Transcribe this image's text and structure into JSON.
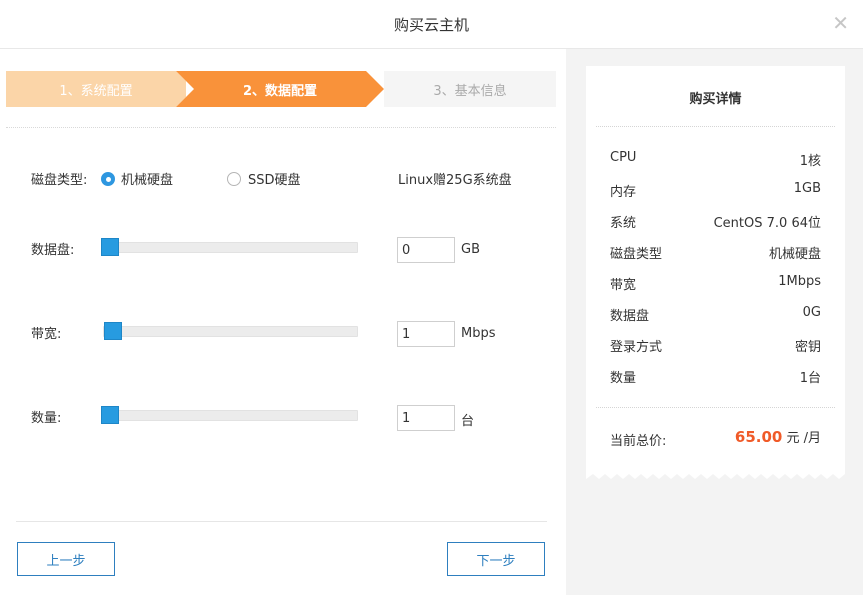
{
  "dialog": {
    "title": "购买云主机",
    "close_glyph": "✕"
  },
  "steps": [
    {
      "label": "1、系统配置",
      "state": "done"
    },
    {
      "label": "2、数据配置",
      "state": "active"
    },
    {
      "label": "3、基本信息",
      "state": "pending"
    }
  ],
  "form": {
    "disk_type": {
      "label": "磁盘类型:",
      "options": [
        "机械硬盘",
        "SSD硬盘"
      ],
      "selected": "机械硬盘",
      "note": "Linux赠25G系统盘"
    },
    "data_disk": {
      "label": "数据盘:",
      "value": "0",
      "unit": "GB",
      "level": 0
    },
    "bandwidth": {
      "label": "带宽:",
      "value": "1",
      "unit": "Mbps",
      "level": 0
    },
    "quantity": {
      "label": "数量:",
      "value": "1",
      "unit": "台",
      "level": 0
    }
  },
  "buttons": {
    "prev": "上一步",
    "next": "下一步"
  },
  "summary": {
    "title": "购买详情",
    "rows": [
      {
        "key": "CPU",
        "value": "1核"
      },
      {
        "key": "内存",
        "value": "1GB"
      },
      {
        "key": "系统",
        "value": "CentOS 7.0 64位"
      },
      {
        "key": "磁盘类型",
        "value": "机械硬盘"
      },
      {
        "key": "带宽",
        "value": "1Mbps"
      },
      {
        "key": "数据盘",
        "value": "0G"
      },
      {
        "key": "登录方式",
        "value": "密钥"
      },
      {
        "key": "数量",
        "value": "1台"
      }
    ],
    "total_label": "当前总价:",
    "total_price": "65.00",
    "total_unit": "元 /月"
  },
  "colors": {
    "accent": "#f9923a",
    "step_done": "#fbd5a8",
    "link_blue": "#2e7fbf",
    "slider_blue": "#279be0",
    "price": "#f05a28"
  }
}
